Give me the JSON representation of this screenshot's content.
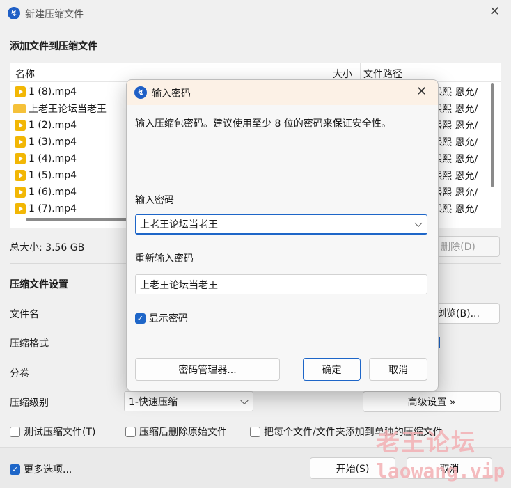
{
  "window": {
    "title": "新建压缩文件",
    "section_add": "添加文件到压缩文件",
    "columns": {
      "name": "名称",
      "size": "大小",
      "path": "文件路径"
    },
    "files": [
      {
        "name": "1 (8).mp4",
        "type": "video",
        "path": "熙熙 恩允/"
      },
      {
        "name": "上老王论坛当老王",
        "type": "folder",
        "path": "熙熙 恩允/"
      },
      {
        "name": "1 (2).mp4",
        "type": "video",
        "path": "熙熙 恩允/"
      },
      {
        "name": "1 (3).mp4",
        "type": "video",
        "path": "熙熙 恩允/"
      },
      {
        "name": "1 (4).mp4",
        "type": "video",
        "path": "熙熙 恩允/"
      },
      {
        "name": "1 (5).mp4",
        "type": "video",
        "path": "熙熙 恩允/"
      },
      {
        "name": "1 (6).mp4",
        "type": "video",
        "path": "熙熙 恩允/"
      },
      {
        "name": "1 (7).mp4",
        "type": "video",
        "path": "熙熙 恩允/"
      }
    ],
    "total_size": "总大小: 3.56 GB",
    "delete_btn": "删除(D)",
    "settings_title": "压缩文件设置",
    "label_filename": "文件名",
    "browse_btn": "浏览(B)...",
    "label_format": "压缩格式",
    "label_split": "分卷",
    "label_level": "压缩级别",
    "level_value": "1-快速压缩",
    "advanced_btn": "高级设置 »",
    "chk_test": "测试压缩文件(T)",
    "chk_delete": "压缩后删除原始文件",
    "chk_each": "把每个文件/文件夹添加到单独的压缩文件",
    "chk_more": "更多选项...",
    "start_btn": "开始(S)",
    "cancel_btn": "取消"
  },
  "dialog": {
    "title": "输入密码",
    "desc": "输入压缩包密码。建议使用至少 8 位的密码来保证安全性。",
    "label_pwd": "输入密码",
    "pwd_value": "上老王论坛当老王",
    "label_repwd": "重新输入密码",
    "repwd_value": "上老王论坛当老王",
    "show_pwd": "显示密码",
    "manager_btn": "密码管理器...",
    "ok_btn": "确定",
    "cancel_btn": "取消"
  },
  "watermark": {
    "line1": "老王论坛",
    "line2": "laowang.vip"
  },
  "colors": {
    "accent": "#1e66c8",
    "dialog_title_bg": "#fcf1e6",
    "video_icon": "#f2b705",
    "folder_icon": "#f5c13a"
  }
}
